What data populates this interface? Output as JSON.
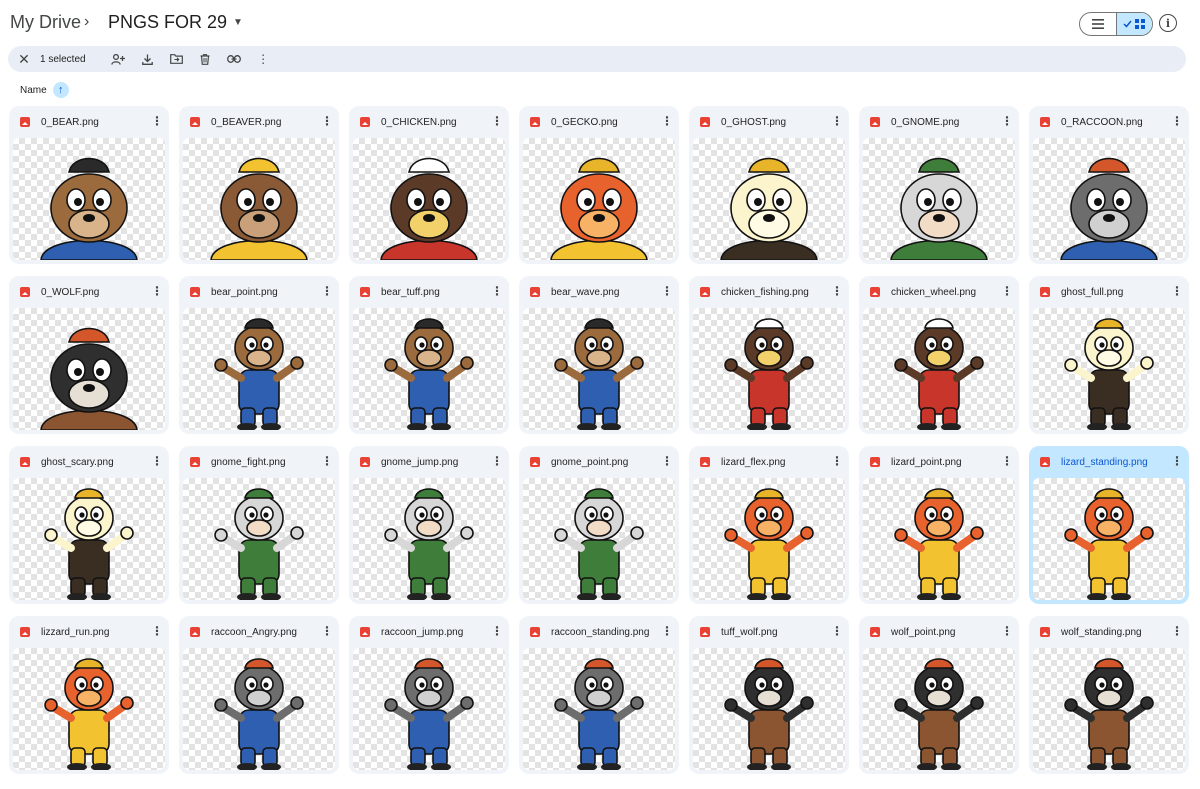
{
  "header": {
    "root": "My Drive",
    "separator": "›",
    "folder": "PNGS FOR 29"
  },
  "toolbar": {
    "selected_text": "1 selected"
  },
  "sort": {
    "label": "Name",
    "direction": "ascending"
  },
  "colors": {
    "accent": "#0b57d0",
    "selected_bg": "#c2e7ff",
    "card_bg": "#f0f4f9",
    "file_icon": "#e94235"
  },
  "files": [
    {
      "name": "0_BEAR.png",
      "character": "bear",
      "pose": "head"
    },
    {
      "name": "0_BEAVER.png",
      "character": "beaver",
      "pose": "head"
    },
    {
      "name": "0_CHICKEN.png",
      "character": "chicken",
      "pose": "head"
    },
    {
      "name": "0_GECKO.png",
      "character": "gecko",
      "pose": "head"
    },
    {
      "name": "0_GHOST.png",
      "character": "ghost",
      "pose": "head"
    },
    {
      "name": "0_GNOME.png",
      "character": "gnome",
      "pose": "head"
    },
    {
      "name": "0_RACCOON.png",
      "character": "raccoon",
      "pose": "head"
    },
    {
      "name": "0_WOLF.png",
      "character": "wolf",
      "pose": "head"
    },
    {
      "name": "bear_point.png",
      "character": "bear",
      "pose": "full"
    },
    {
      "name": "bear_tuff.png",
      "character": "bear",
      "pose": "full"
    },
    {
      "name": "bear_wave.png",
      "character": "bear",
      "pose": "full"
    },
    {
      "name": "chicken_fishing.png",
      "character": "chicken",
      "pose": "full"
    },
    {
      "name": "chicken_wheel.png",
      "character": "chicken",
      "pose": "full"
    },
    {
      "name": "ghost_full.png",
      "character": "ghost",
      "pose": "full"
    },
    {
      "name": "ghost_scary.png",
      "character": "ghost",
      "pose": "full"
    },
    {
      "name": "gnome_fight.png",
      "character": "gnome",
      "pose": "full"
    },
    {
      "name": "gnome_jump.png",
      "character": "gnome",
      "pose": "full"
    },
    {
      "name": "gnome_point.png",
      "character": "gnome",
      "pose": "full"
    },
    {
      "name": "lizard_flex.png",
      "character": "gecko",
      "pose": "full"
    },
    {
      "name": "lizard_point.png",
      "character": "gecko",
      "pose": "full"
    },
    {
      "name": "lizard_standing.png",
      "character": "gecko",
      "pose": "full",
      "selected": true
    },
    {
      "name": "lizzard_run.png",
      "character": "gecko",
      "pose": "full"
    },
    {
      "name": "raccoon_Angry.png",
      "character": "raccoon",
      "pose": "full"
    },
    {
      "name": "raccoon_jump.png",
      "character": "raccoon",
      "pose": "full"
    },
    {
      "name": "raccoon_standing.png",
      "character": "raccoon",
      "pose": "full"
    },
    {
      "name": "tuff_wolf.png",
      "character": "wolf",
      "pose": "full"
    },
    {
      "name": "wolf_point.png",
      "character": "wolf",
      "pose": "full"
    },
    {
      "name": "wolf_standing.png",
      "character": "wolf",
      "pose": "full"
    }
  ]
}
